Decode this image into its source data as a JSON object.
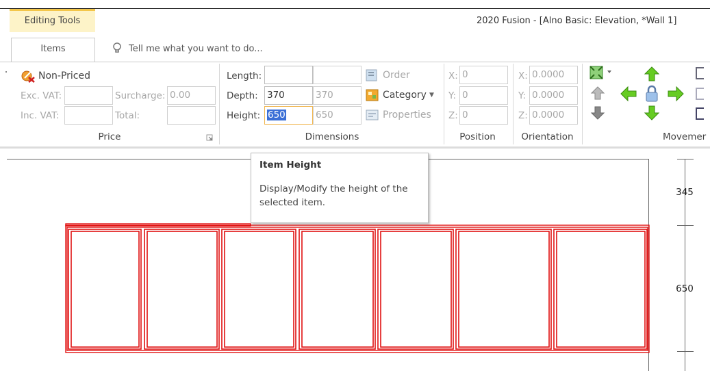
{
  "titlebar": {
    "context_tab": "Editing Tools",
    "app_title": "2020 Fusion - [Alno Basic: Elevation, *Wall 1]"
  },
  "tabs": {
    "items_label": "Items",
    "tellme": "Tell me what you want to do..."
  },
  "price": {
    "nonpriced_label": "Non-Priced",
    "exc_vat_label": "Exc. VAT:",
    "exc_vat_value": "",
    "inc_vat_label": "Inc. VAT:",
    "inc_vat_value": "",
    "surcharge_label": "Surcharge:",
    "surcharge_value": "0.00",
    "total_label": "Total:",
    "total_value": "",
    "group_label": "Price"
  },
  "dimensions": {
    "length_label": "Length:",
    "length_value": "",
    "length_alt_value": "",
    "depth_label": "Depth:",
    "depth_value": "370",
    "depth_alt_value": "370",
    "height_label": "Height:",
    "height_value": "650",
    "height_alt_value": "650",
    "order_label": "Order",
    "category_label": "Category",
    "properties_label": "Properties",
    "group_label": "Dimensions"
  },
  "position": {
    "x_label": "X:",
    "x_value": "0",
    "y_label": "Y:",
    "y_value": "0",
    "z_label": "Z:",
    "z_value": "0",
    "group_label": "Position"
  },
  "orientation": {
    "x_label": "X:",
    "x_value": "0.0000",
    "y_label": "Y:",
    "y_value": "0.0000",
    "z_label": "Z:",
    "z_value": "0.0000",
    "group_label": "Orientation"
  },
  "movement": {
    "group_label": "Movemer"
  },
  "tooltip": {
    "title": "Item Height",
    "body": "Display/Modify the height of the selected item."
  },
  "ruler": {
    "upper_dim": "345",
    "lower_dim": "650"
  },
  "colors": {
    "accent_tab": "#f3c64a",
    "selection": "#3b6fd6",
    "cabinet_lines": "#e01010",
    "arrow_green": "#5cc01e",
    "arrow_gray": "#8a8a8a"
  },
  "icons": [
    "non-priced-icon",
    "lightbulb-icon",
    "order-icon",
    "category-icon",
    "properties-icon",
    "zoom-extents-icon",
    "arrow-up-icon",
    "arrow-down-icon",
    "arrow-left-icon",
    "arrow-right-icon",
    "lock-icon",
    "dialog-launcher-icon"
  ]
}
